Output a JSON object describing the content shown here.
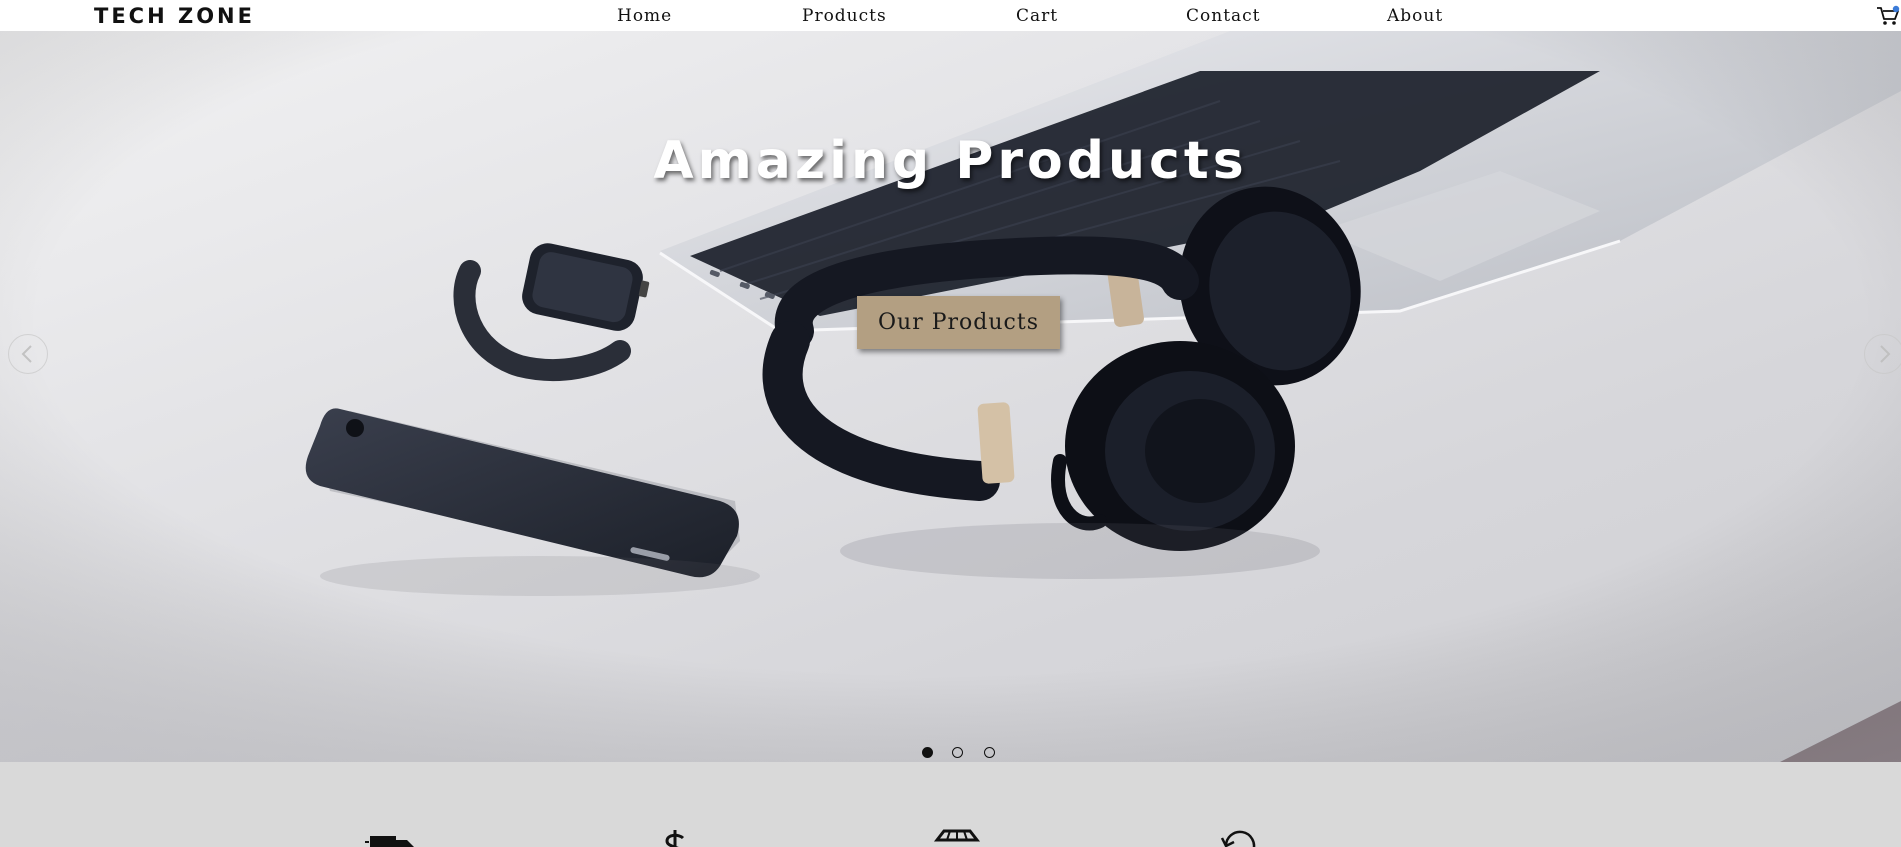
{
  "navbar": {
    "brand": "TECH ZONE",
    "links": [
      {
        "label": "Home"
      },
      {
        "label": "Products"
      },
      {
        "label": "Cart"
      },
      {
        "label": "Contact"
      },
      {
        "label": "About"
      }
    ],
    "cart_icon": "shopping-cart-icon"
  },
  "hero": {
    "title": "Amazing Products",
    "button_label": "Our Products",
    "prev_icon": "chevron-left-icon",
    "next_icon": "chevron-right-icon",
    "slides": {
      "count": 3,
      "active_index": 1
    }
  },
  "features": {
    "icons": [
      "delivery-truck-icon",
      "dollar-icon",
      "store-icon",
      "return-icon"
    ]
  },
  "colors": {
    "navbar_bg": "#ffffff",
    "button_bg": "#b39f82",
    "strip_bg": "#d9d9d9",
    "text_dark": "#111111"
  }
}
